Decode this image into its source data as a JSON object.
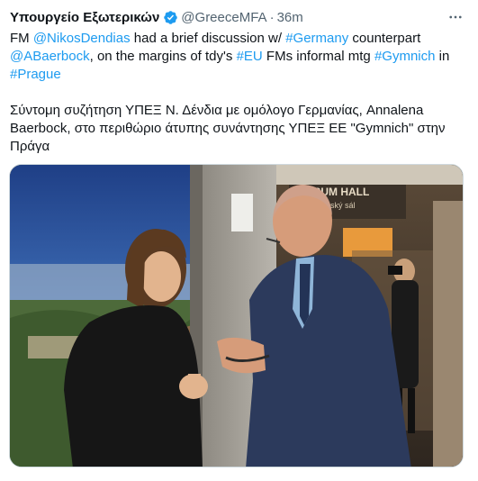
{
  "tweet": {
    "author_name": "Υπουργείο Εξωτερικών",
    "handle": "@GreeceMFA",
    "separator": "·",
    "timestamp": "36m",
    "verified_icon": "verified-badge-icon",
    "more_icon": "more-horizontal-icon",
    "english": [
      {
        "text": "FM ",
        "link": false
      },
      {
        "text": "@NikosDendias",
        "link": true
      },
      {
        "text": " had a brief discussion w/ ",
        "link": false
      },
      {
        "text": "#Germany",
        "link": true
      },
      {
        "text": " counterpart ",
        "link": false
      },
      {
        "text": "@ABaerbock",
        "link": true
      },
      {
        "text": ", on the margins of tdy's ",
        "link": false
      },
      {
        "text": "#EU",
        "link": true
      },
      {
        "text": " FMs informal mtg ",
        "link": false
      },
      {
        "text": "#Gymnich",
        "link": true
      },
      {
        "text": " in ",
        "link": false
      },
      {
        "text": "#Prague",
        "link": true
      }
    ],
    "greek": "Σύντομη συζήτηση ΥΠΕΞ Ν. Δένδια με ομόλογο Γερμανίας, Annalena Baerbock, στο περιθώριο άτυπης συνάντησης ΥΠΕΞ ΕΕ \"Gymnich\" στην Πράγα",
    "photo": {
      "sign_line1": "FORUM HALL",
      "sign_line2": "orenský sál"
    },
    "colors": {
      "link": "#1d9bf0",
      "secondary": "#536471",
      "verified": "#1d9bf0"
    }
  }
}
